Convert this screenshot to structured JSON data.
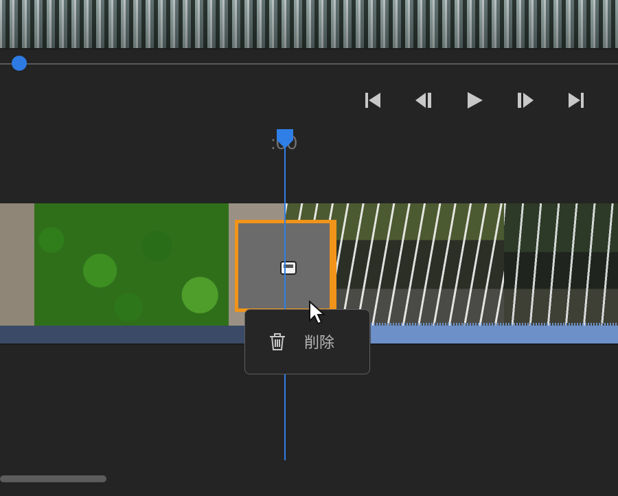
{
  "player": {
    "timecode": ":00",
    "controls": [
      {
        "name": "skip-to-start",
        "icon": "skip-start-icon"
      },
      {
        "name": "step-back",
        "icon": "frame-back-icon"
      },
      {
        "name": "play",
        "icon": "play-icon"
      },
      {
        "name": "step-forward",
        "icon": "frame-forward-icon"
      },
      {
        "name": "skip-to-end",
        "icon": "skip-end-icon"
      }
    ],
    "progress": 0.03
  },
  "timeline": {
    "clips": [
      "forest-aerial",
      "waterfall-1",
      "waterfall-2"
    ],
    "transition": {
      "icon": "transition-icon",
      "selected": true
    }
  },
  "context_menu": {
    "items": [
      {
        "label": "削除",
        "icon": "trash-icon"
      }
    ]
  },
  "colors": {
    "accent": "#2d7be3",
    "selection": "#f19419",
    "audio": "#6e90c8"
  }
}
